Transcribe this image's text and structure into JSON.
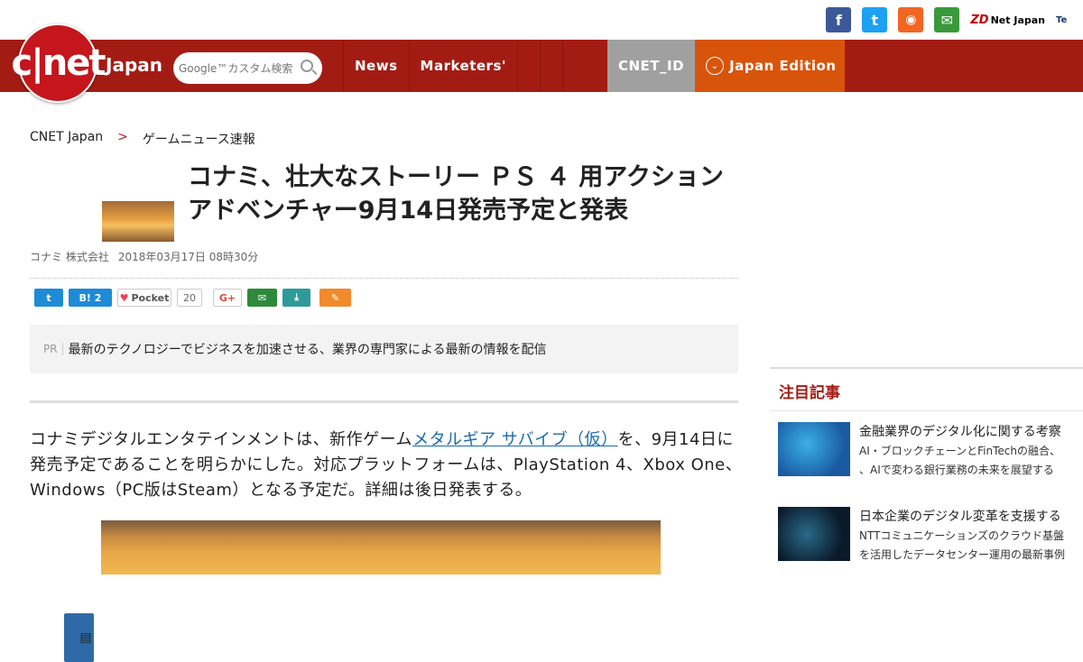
{
  "header": {
    "social": [
      "facebook-icon",
      "twitter-icon",
      "rss-icon",
      "mail-icon"
    ],
    "zdnet_label": "Net Japan",
    "techrepublic_label": "Te"
  },
  "nav": {
    "logo_text": "c|net",
    "logo_sub": "Japan",
    "search_placeholder": "Google™カスタム検索",
    "links": [
      "News",
      "Marketers'"
    ],
    "cnet_id": "CNET_ID",
    "edition": "Japan Edition"
  },
  "breadcrumb": {
    "home": "CNET Japan",
    "sep": ">",
    "current": "ゲームニュース速報"
  },
  "article": {
    "title": "コナミ、壮大なストーリー ＰＳ ４ 用アクションアドベンチャー9月14日発売予定と発表",
    "author": "コナミ 株式会社",
    "date": "2018年03月17日 08時30分",
    "pocket_label": "Pocket",
    "pocket_count": "20",
    "hatena_count": "2",
    "pr_tag": "PR",
    "pr_text": "最新のテクノロジーでビジネスを加速させる、業界の専門家による最新の情報を配信",
    "body_before": "コナミデジタルエンタテインメントは、新作ゲーム",
    "body_link": "メタルギア サバイブ（仮）",
    "body_after": "を、9月14日に発売予定であることを明らかにした。対応プラットフォームは、PlayStation 4、Xbox One、Windows（PC版はSteam）となる予定だ。詳細は後日発表する。"
  },
  "sidebar": {
    "heading": "注目記事",
    "items": [
      {
        "title": "金融業界のデジタル化に関する考察",
        "sub1": "AI・ブロックチェーンとFinTechの融合、",
        "sub2": "、AIで変わる銀行業務の未来を展望する"
      },
      {
        "title": "日本企業のデジタル変革を支援する",
        "sub1": "NTTコミュニケーションズのクラウド基盤",
        "sub2": "を活用したデータセンター運用の最新事例"
      }
    ]
  }
}
